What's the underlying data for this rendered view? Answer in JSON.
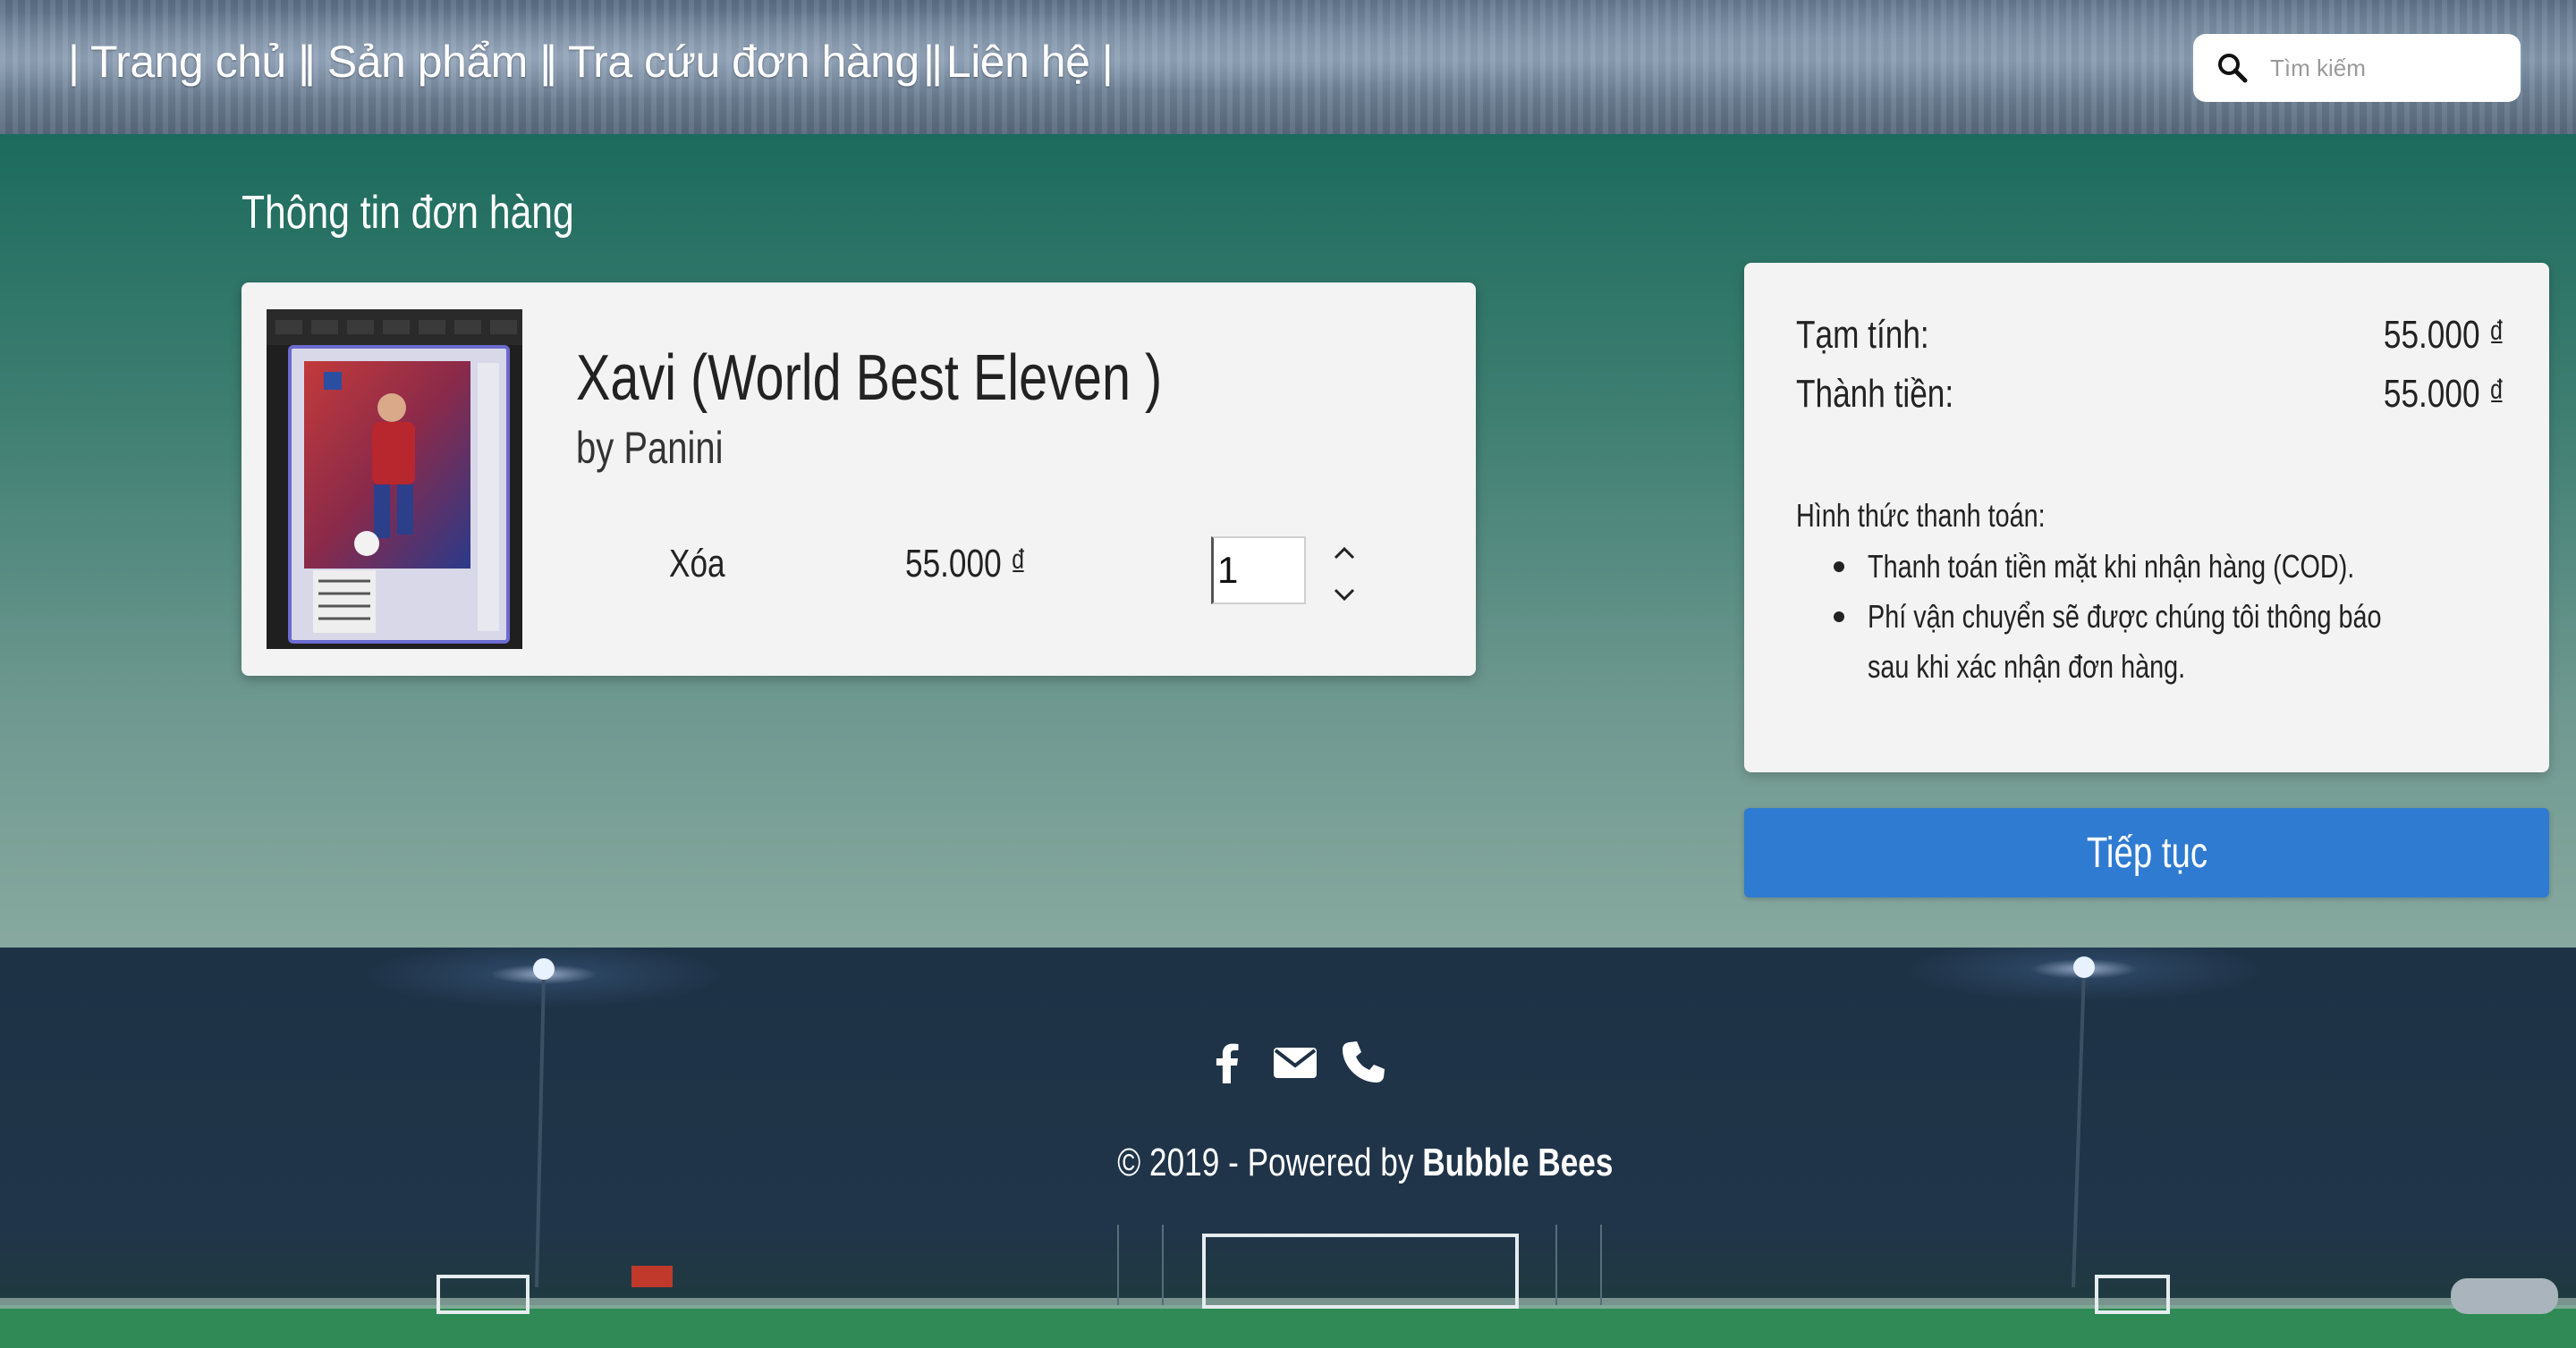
{
  "nav": {
    "items": [
      {
        "label": "| Trang chủ |"
      },
      {
        "label": "| Sản phẩm |"
      },
      {
        "label": "| Tra cứu đơn hàng |"
      },
      {
        "label": "| Liên hệ |"
      }
    ]
  },
  "search": {
    "placeholder": "Tìm kiếm",
    "value": ""
  },
  "order": {
    "title": "Thông tin đơn hàng",
    "product": {
      "name": "Xavi (World Best Eleven )",
      "brand": "by Panini",
      "delete_label": "Xóa",
      "price": "55.000 ₫",
      "quantity": "1"
    }
  },
  "summary": {
    "subtotal_label": "Tạm tính:",
    "subtotal_value": "55.000 ₫",
    "total_label": "Thành tiền:",
    "total_value": "55.000 ₫",
    "payment_title": "Hình thức thanh toán:",
    "payment_notes": [
      "Thanh toán tiền mặt khi nhận hàng (COD).",
      "Phí vận chuyển sẽ được chúng tôi thông báo sau khi xác nhận đơn hàng."
    ]
  },
  "continue_label": "Tiếp tục",
  "footer": {
    "icons": [
      "facebook-icon",
      "email-icon",
      "phone-icon"
    ],
    "copyright_prefix": "© 2019 - Powered by ",
    "brand": "Bubble Bees"
  },
  "colors": {
    "button": "#2f7bd1",
    "main_top": "#1c6b5d",
    "main_bottom": "#87a99f",
    "footer": "#1e3246"
  }
}
